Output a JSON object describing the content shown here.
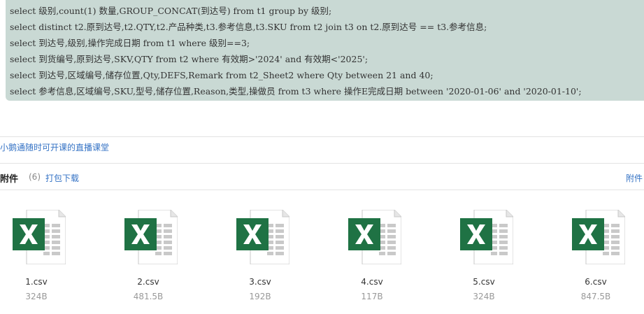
{
  "code": {
    "lines": [
      "select 级别,count(1) 数量,GROUP_CONCAT(到达号) from t1 group by 级别;",
      "select distinct t2.原到达号,t2.QTY,t2.产品种类,t3.参考信息,t3.SKU from t2 join t3 on t2.原到达号 == t3.参考信息;",
      "select 到达号,级别,操作完成日期 from t1 where 级别==3;",
      "select 到货编号,原到达号,SKV,QTY from t2 where 有效期>'2024' and 有效期<'2025';",
      "select 到达号,区域编号,储存位置,Qty,DEFS,Remark from t2_Sheet2 where Qty between 21 and 40;",
      "select 参考信息,区域编号,SKU,型号,储存位置,Reason,类型,操做员 from t3 where 操作E完成日期 between '2020-01-06' and '2020-01-10';"
    ]
  },
  "promo": {
    "link_text": "小鹅通随时可开课的直播课堂"
  },
  "attachments": {
    "title": "附件",
    "count": "(6)",
    "pack_download": "打包下载",
    "right_label": "附件",
    "files": [
      {
        "name": "1.csv",
        "size": "324B",
        "icon": "excel-icon"
      },
      {
        "name": "2.csv",
        "size": "481.5B",
        "icon": "excel-icon"
      },
      {
        "name": "3.csv",
        "size": "192B",
        "icon": "excel-icon"
      },
      {
        "name": "4.csv",
        "size": "117B",
        "icon": "excel-icon"
      },
      {
        "name": "5.csv",
        "size": "324B",
        "icon": "excel-icon"
      },
      {
        "name": "6.csv",
        "size": "847.5B",
        "icon": "excel-icon"
      }
    ]
  },
  "colors": {
    "code_bg": "#c9d9d4",
    "link": "#3573c5",
    "excel_green": "#1f7244"
  }
}
